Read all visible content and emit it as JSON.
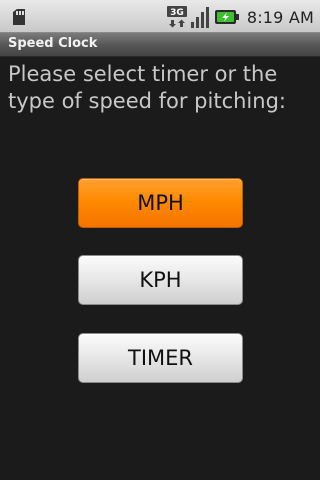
{
  "status_bar": {
    "time": "8:19 AM",
    "icons": [
      "sd-card-icon",
      "3g-network-icon",
      "signal-strength-icon",
      "battery-charging-icon"
    ],
    "network_label": "3G"
  },
  "app": {
    "title": "Speed Clock"
  },
  "main": {
    "prompt": "Please select timer or the type of speed for pitching:",
    "buttons": [
      {
        "label": "MPH",
        "state": "pressed"
      },
      {
        "label": "KPH",
        "state": "normal"
      },
      {
        "label": "TIMER",
        "state": "normal"
      }
    ]
  },
  "colors": {
    "background": "#1b1b1b",
    "accent_pressed": "#ff8a00",
    "prompt_text": "#c8c8c8"
  }
}
